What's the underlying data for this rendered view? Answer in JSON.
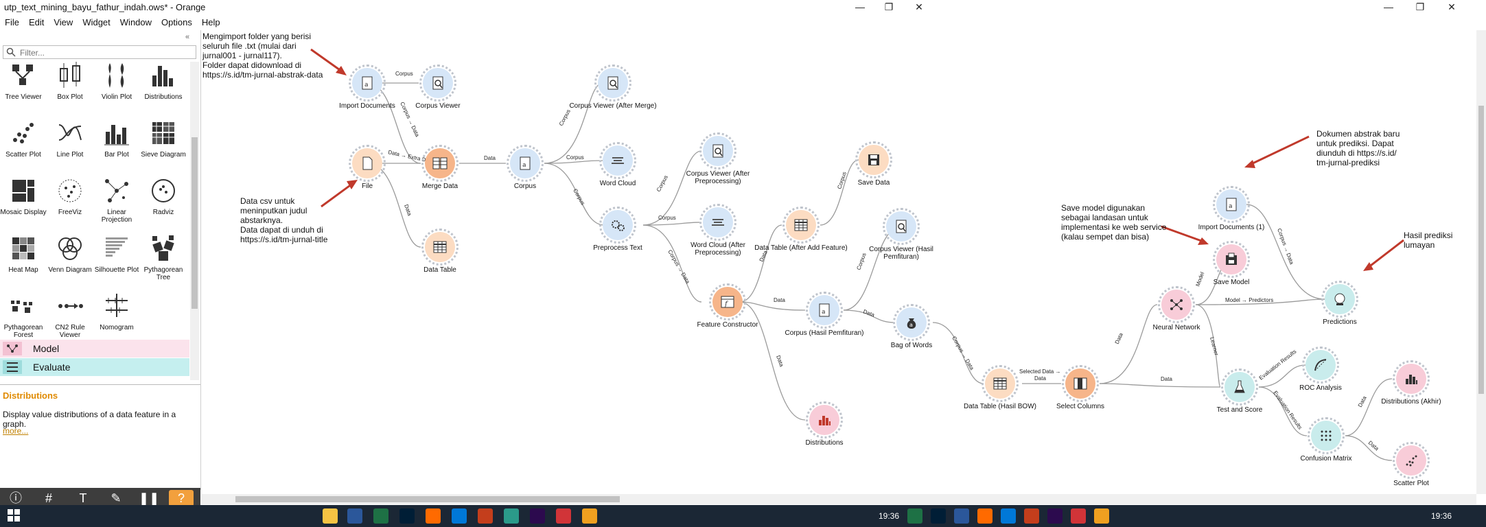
{
  "window": {
    "title": "utp_text_mining_bayu_fathur_indah.ows* - Orange",
    "minimize": "—",
    "maximize": "❐",
    "close": "✕"
  },
  "menu": [
    "File",
    "Edit",
    "View",
    "Widget",
    "Window",
    "Options",
    "Help"
  ],
  "left_panel": {
    "filter_placeholder": "Filter...",
    "collapse": "«",
    "widgets": [
      {
        "label": "Tree Viewer",
        "icon": "tree-viewer-icon"
      },
      {
        "label": "Box Plot",
        "icon": "box-plot-icon"
      },
      {
        "label": "Violin Plot",
        "icon": "violin-plot-icon"
      },
      {
        "label": "Distributions",
        "icon": "distributions-icon"
      },
      {
        "label": "Scatter Plot",
        "icon": "scatter-plot-icon"
      },
      {
        "label": "Line Plot",
        "icon": "line-plot-icon"
      },
      {
        "label": "Bar Plot",
        "icon": "bar-plot-icon"
      },
      {
        "label": "Sieve Diagram",
        "icon": "sieve-diagram-icon"
      },
      {
        "label": "Mosaic Display",
        "icon": "mosaic-display-icon"
      },
      {
        "label": "FreeViz",
        "icon": "freeviz-icon"
      },
      {
        "label": "Linear Projection",
        "icon": "linear-projection-icon"
      },
      {
        "label": "Radviz",
        "icon": "radviz-icon"
      },
      {
        "label": "Heat Map",
        "icon": "heat-map-icon"
      },
      {
        "label": "Venn Diagram",
        "icon": "venn-diagram-icon"
      },
      {
        "label": "Silhouette Plot",
        "icon": "silhouette-plot-icon"
      },
      {
        "label": "Pythagorean Tree",
        "icon": "pythagorean-tree-icon"
      },
      {
        "label": "Pythagorean Forest",
        "icon": "pythagorean-forest-icon"
      },
      {
        "label": "CN2 Rule Viewer",
        "icon": "cn2-rule-viewer-icon"
      },
      {
        "label": "Nomogram",
        "icon": "nomogram-icon"
      }
    ],
    "categories": [
      {
        "label": "Model",
        "color": "#f3c1d2"
      },
      {
        "label": "Evaluate",
        "color": "#c5efef"
      }
    ],
    "info": {
      "title": "Distributions",
      "description": "Display value distributions of a data feature in a graph.",
      "more": "more..."
    }
  },
  "nodes": {
    "import_documents": "Import Documents",
    "corpus_viewer": "Corpus Viewer",
    "file": "File",
    "merge_data": "Merge Data",
    "data_table": "Data Table",
    "corpus": "Corpus",
    "corpus_viewer_after_merge": "Corpus Viewer (After Merge)",
    "word_cloud": "Word Cloud",
    "preprocess_text": "Preprocess Text",
    "corpus_viewer_after_preprocessing": "Corpus Viewer (After Preprocessing)",
    "word_cloud_after_preprocessing": "Word Cloud (After Preprocessing)",
    "feature_constructor": "Feature Constructor",
    "data_table_after_add_feature": "Data Table (After Add Feature)",
    "save_data": "Save Data",
    "corpus_viewer_hasil_pemfituran": "Corpus Viewer (Hasil Pemfituran)",
    "corpus_hasil_pemfituran": "Corpus (Hasil Pemfituran)",
    "bag_of_words": "Bag of Words",
    "distributions": "Distributions",
    "data_table_hasil_bow": "Data Table (Hasil BOW)",
    "select_columns": "Select Columns",
    "neural_network": "Neural Network",
    "save_model": "Save Model",
    "import_documents_1": "Import Documents (1)",
    "predictions": "Predictions",
    "test_and_score": "Test and Score",
    "roc_analysis": "ROC Analysis",
    "confusion_matrix": "Confusion Matrix",
    "distributions_akhir": "Distributions (Akhir)",
    "scatter_plot": "Scatter Plot"
  },
  "edges": {
    "e1": "Corpus",
    "e2": "Corpus → Data",
    "e3": "Data → Extra Data",
    "e4": "Data",
    "e5": "Data",
    "e6": "Corpus",
    "e7": "Corpus",
    "e8": "Corpus",
    "e9": "Corpus",
    "e10": "Corpus",
    "e11": "Corpus → Data",
    "e12": "Data",
    "e13": "Data",
    "e14": "Data",
    "e15": "Corpus",
    "e16": "Corpus",
    "e17": "Data",
    "e18": "Corpus → Data",
    "e19a": "Selected Data →",
    "e19b": "Data",
    "e20": "Data",
    "e21": "Data",
    "e22": "Model",
    "e23": "Model → Predictors",
    "e24": "Learner",
    "e25": "Corpus → Data",
    "e26": "Evaluation Results",
    "e27": "Evaluation Results",
    "e28": "Data",
    "e29": "Data"
  },
  "notes": {
    "import_note": [
      "Mengimport folder yang berisi",
      "seluruh file .txt (mulai dari",
      "jurnal001 - jurnal117).",
      "Folder dapat didownload di",
      "https://s.id/tm-jurnal-abstrak-data"
    ],
    "csv_note": [
      "Data csv untuk",
      "meninputkan judul",
      "abstarknya.",
      "Data dapat di unduh di",
      "https://s.id/tm-jurnal-title"
    ],
    "save_model_note": [
      "Save model digunakan",
      "sebagai landasan untuk",
      "implementasi ke web service",
      "(kalau sempet dan bisa)"
    ],
    "new_doc_note": [
      "Dokumen abstrak baru",
      "untuk prediksi. Dapat",
      "diunduh di https://s.id/",
      "tm-jurnal-prediksi"
    ],
    "prediction_note": [
      "Hasil prediksi",
      "lumayan"
    ]
  },
  "taskbar": {
    "time": "19:36",
    "time2": "19:36",
    "app_colors": [
      "#f6c343",
      "#2b579a",
      "#1e7145",
      "#001e36",
      "#ff6a00",
      "#0078d7",
      "#c43e1c",
      "#2b9a8a",
      "#2c0a4e",
      "#d13438",
      "#f0a020"
    ]
  }
}
